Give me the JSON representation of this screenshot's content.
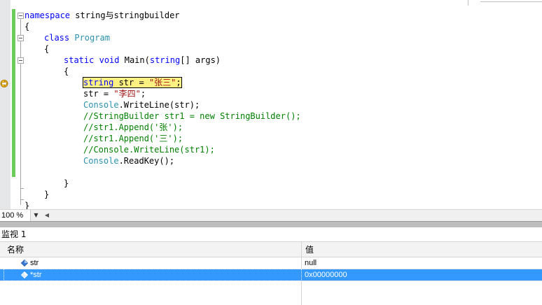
{
  "editor": {
    "lines": [
      {
        "indent": 0,
        "tokens": [
          {
            "t": "namespace",
            "c": "kw"
          },
          {
            "t": " string与stringbuilder",
            "c": ""
          }
        ]
      },
      {
        "indent": 0,
        "tokens": [
          {
            "t": "{",
            "c": ""
          }
        ]
      },
      {
        "indent": 1,
        "tokens": [
          {
            "t": "class",
            "c": "kw"
          },
          {
            "t": " ",
            "c": ""
          },
          {
            "t": "Program",
            "c": "ty"
          }
        ]
      },
      {
        "indent": 1,
        "tokens": [
          {
            "t": "{",
            "c": ""
          }
        ]
      },
      {
        "indent": 2,
        "tokens": [
          {
            "t": "static",
            "c": "kw"
          },
          {
            "t": " ",
            "c": ""
          },
          {
            "t": "void",
            "c": "kw"
          },
          {
            "t": " Main(",
            "c": ""
          },
          {
            "t": "string",
            "c": "kw"
          },
          {
            "t": "[] args)",
            "c": ""
          }
        ]
      },
      {
        "indent": 2,
        "tokens": [
          {
            "t": "{",
            "c": ""
          }
        ]
      },
      {
        "indent": 3,
        "current": true,
        "tokens": [
          {
            "t": "string",
            "c": "kw"
          },
          {
            "t": " str = ",
            "c": ""
          },
          {
            "t": "\"张三\"",
            "c": "str"
          },
          {
            "t": ";",
            "c": ""
          }
        ]
      },
      {
        "indent": 3,
        "tokens": [
          {
            "t": "str = ",
            "c": ""
          },
          {
            "t": "\"李四\"",
            "c": "str"
          },
          {
            "t": ";",
            "c": ""
          }
        ]
      },
      {
        "indent": 3,
        "tokens": [
          {
            "t": "Console",
            "c": "ty"
          },
          {
            "t": ".WriteLine(str);",
            "c": ""
          }
        ]
      },
      {
        "indent": 3,
        "tokens": [
          {
            "t": "//StringBuilder str1 = new StringBuilder();",
            "c": "cm"
          }
        ]
      },
      {
        "indent": 3,
        "tokens": [
          {
            "t": "//str1.Append('张');",
            "c": "cm"
          }
        ]
      },
      {
        "indent": 3,
        "tokens": [
          {
            "t": "//str1.Append('三');",
            "c": "cm"
          }
        ]
      },
      {
        "indent": 3,
        "tokens": [
          {
            "t": "//Console.WriteLine(str1);",
            "c": "cm"
          }
        ]
      },
      {
        "indent": 3,
        "tokens": [
          {
            "t": "Console",
            "c": "ty"
          },
          {
            "t": ".ReadKey();",
            "c": ""
          }
        ]
      },
      {
        "indent": 0,
        "tokens": []
      },
      {
        "indent": 2,
        "tokens": [
          {
            "t": "}",
            "c": ""
          }
        ]
      },
      {
        "indent": 1,
        "tokens": [
          {
            "t": "}",
            "c": ""
          }
        ]
      },
      {
        "indent": 0,
        "tokens": [
          {
            "t": "}",
            "c": ""
          }
        ]
      }
    ]
  },
  "zoom": {
    "level": "100 %",
    "dropdown_glyph": "▼",
    "scroll_left_glyph": "◀"
  },
  "watch": {
    "title": "监视 1",
    "columns": {
      "name": "名称",
      "value": "值"
    },
    "rows": [
      {
        "name": "str",
        "value": "null",
        "selected": false
      },
      {
        "name": "*str",
        "value": "0x00000000",
        "selected": true
      }
    ]
  },
  "colors": {
    "keyword": "#0000ff",
    "type": "#2b91af",
    "string": "#a31515",
    "comment": "#008000",
    "current_line": "#fff181",
    "change_bar": "#6ccd5a",
    "selection": "#3399ff"
  },
  "icons": {
    "execution_pointer": "current-statement-arrow-icon",
    "watch_item": "variable-diamond-icon"
  }
}
